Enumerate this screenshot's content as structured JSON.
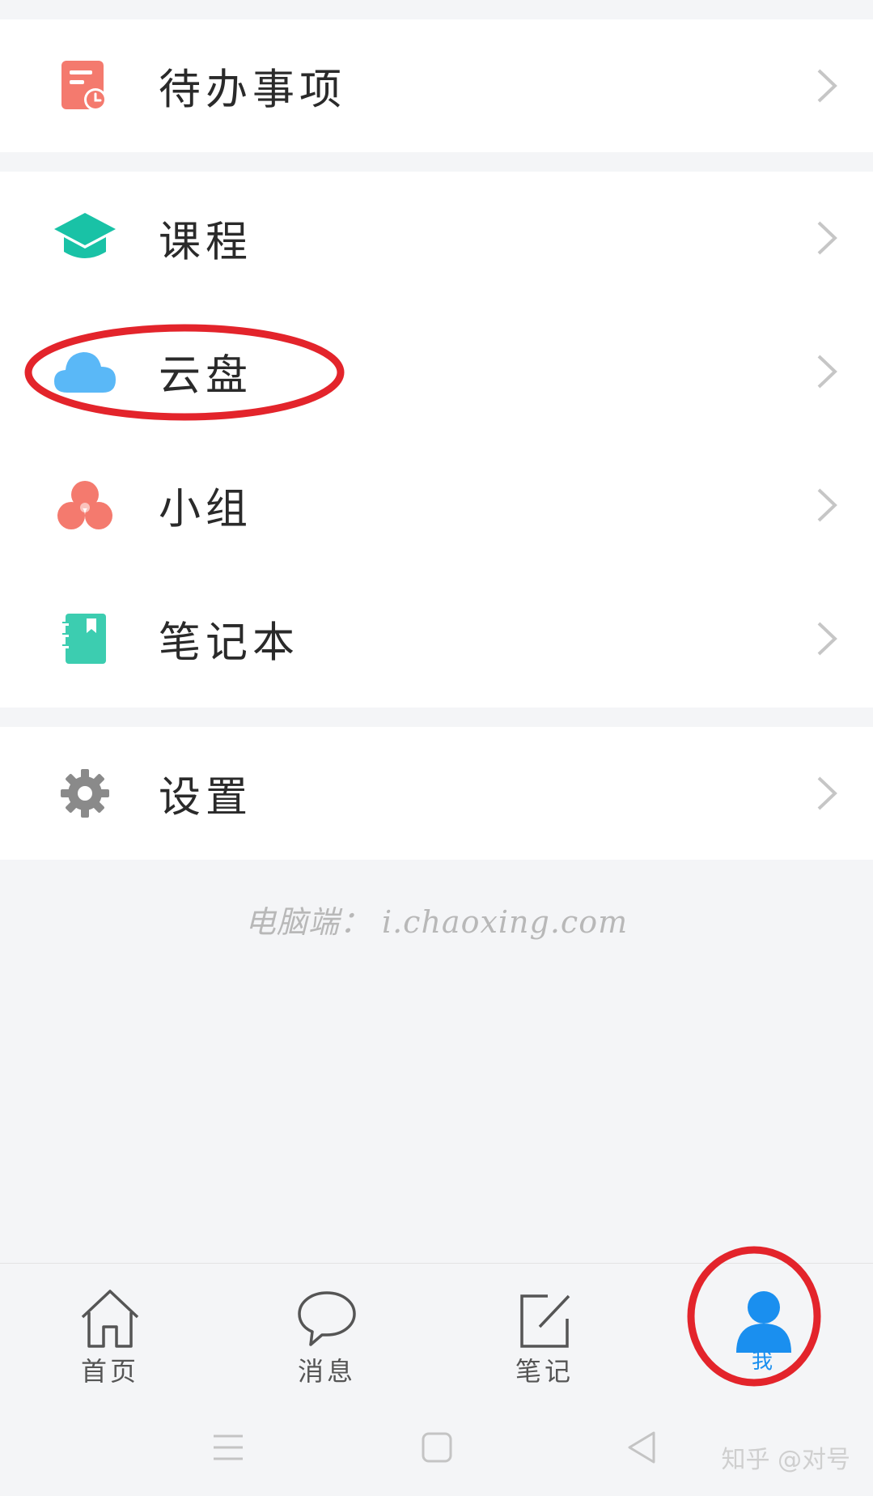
{
  "menu": {
    "todo": {
      "label": "待办事项",
      "icon": "todo-clock-icon"
    },
    "course": {
      "label": "课程",
      "icon": "graduation-cap-icon"
    },
    "cloud": {
      "label": "云盘",
      "icon": "cloud-icon"
    },
    "group": {
      "label": "小组",
      "icon": "group-circles-icon"
    },
    "notebook": {
      "label": "笔记本",
      "icon": "notebook-icon"
    },
    "settings": {
      "label": "设置",
      "icon": "gear-icon"
    }
  },
  "footer": {
    "text": "电脑端： i.chaoxing.com"
  },
  "tabbar": {
    "home": {
      "label": "首页",
      "icon": "home-icon"
    },
    "messages": {
      "label": "消息",
      "icon": "chat-bubble-icon"
    },
    "notes": {
      "label": "笔记",
      "icon": "edit-note-icon"
    },
    "me": {
      "label": "我",
      "icon": "user-icon",
      "active": true
    }
  },
  "watermark": "知乎 @对号",
  "colors": {
    "todo": "#f47a6e",
    "course": "#19c2a6",
    "cloud": "#5ab8f7",
    "group": "#f47a6e",
    "notebook": "#3ccdb0",
    "settings": "#8a8a8a",
    "active_tab": "#1a8fef",
    "annotation": "#e3242b"
  }
}
